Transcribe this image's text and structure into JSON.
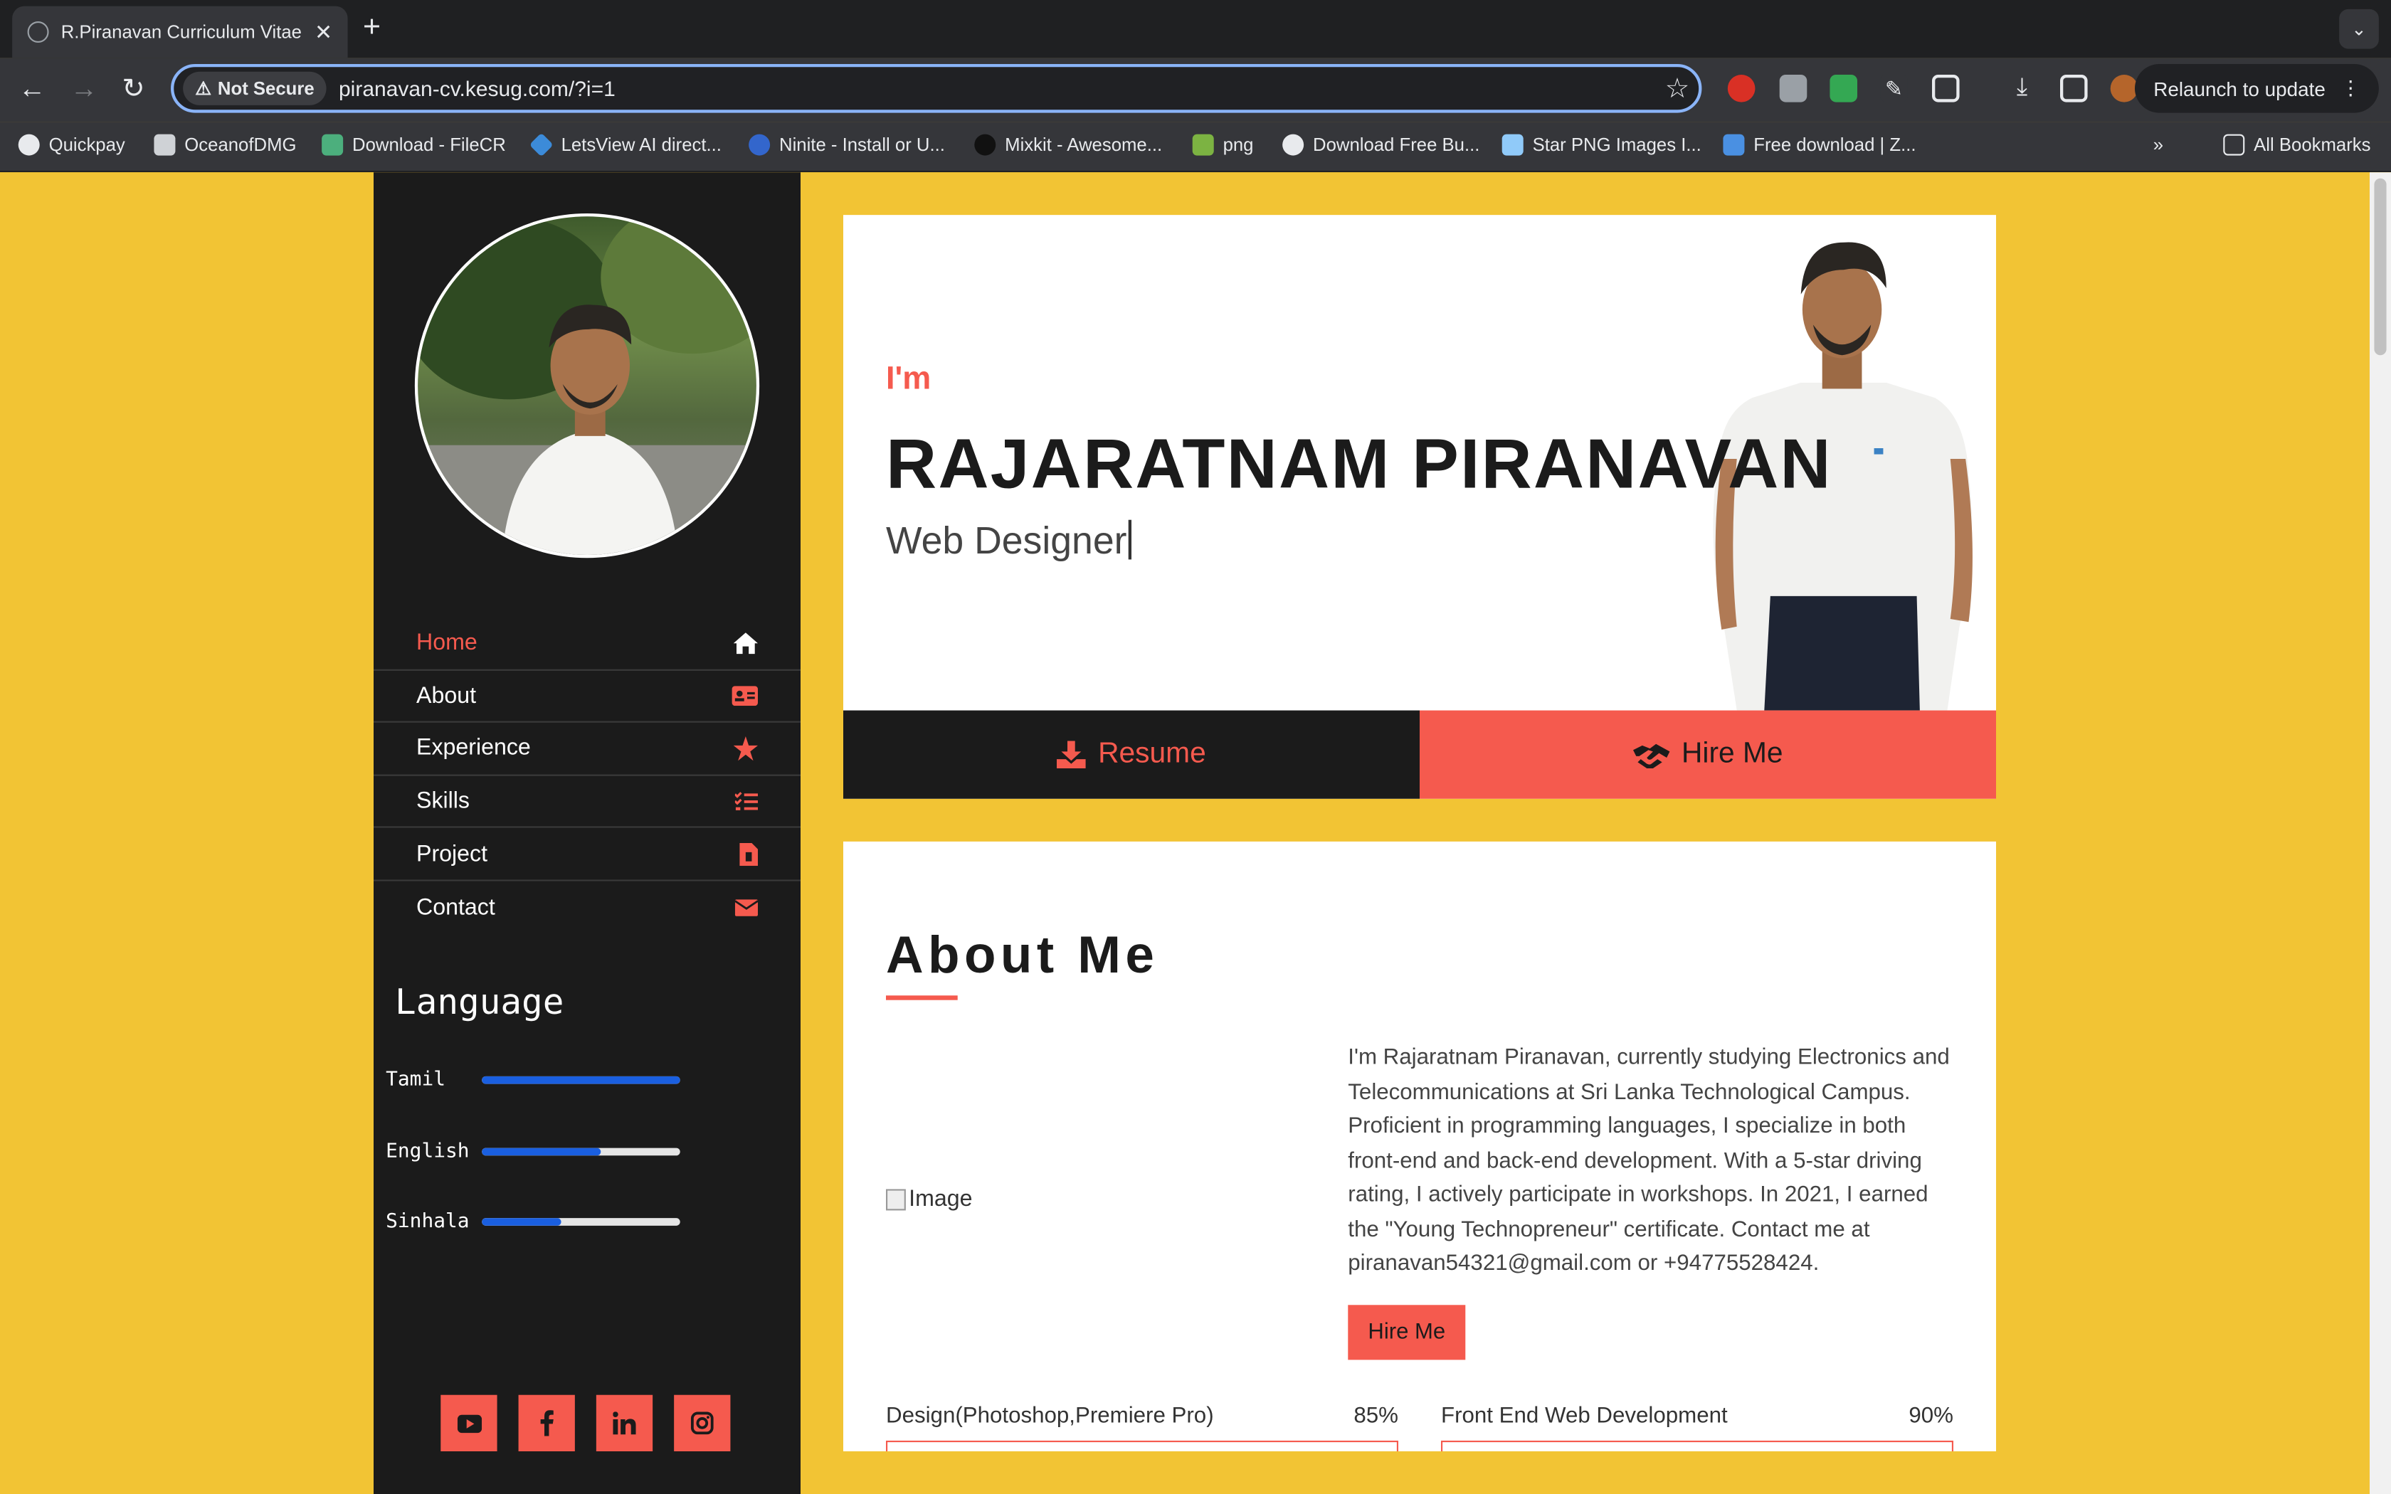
{
  "browser": {
    "tab_title": "R.Piranavan Curriculum Vitae",
    "tab_close": "✕",
    "new_tab": "+",
    "not_secure_label": "Not Secure",
    "url": "piranavan-cv.kesug.com/?i=1",
    "relaunch_label": "Relaunch to update",
    "bookmarks": [
      "Quickpay",
      "OceanofDMG",
      "Download - FileCR",
      "LetsView AI direct...",
      "Ninite - Install or U...",
      "Mixkit - Awesome...",
      "png",
      "Download Free Bu...",
      "Star PNG Images I...",
      "Free download | Z..."
    ],
    "all_bookmarks_label": "All Bookmarks"
  },
  "sidebar": {
    "menu": [
      {
        "label": "Home",
        "icon": "home-icon",
        "active": true
      },
      {
        "label": "About",
        "icon": "id-card-icon",
        "active": false
      },
      {
        "label": "Experience",
        "icon": "star-icon",
        "active": false
      },
      {
        "label": "Skills",
        "icon": "list-check-icon",
        "active": false
      },
      {
        "label": "Project",
        "icon": "file-icon",
        "active": false
      },
      {
        "label": "Contact",
        "icon": "envelope-icon",
        "active": false
      }
    ],
    "language_title": "Language",
    "languages": [
      {
        "name": "Tamil",
        "level": 1.0
      },
      {
        "name": "English",
        "level": 0.6
      },
      {
        "name": "Sinhala",
        "level": 0.4
      }
    ],
    "socials": [
      "youtube-icon",
      "facebook-icon",
      "linkedin-icon",
      "instagram-icon"
    ]
  },
  "hero": {
    "intro": "I'm",
    "name": "RAJARATNAM PIRANAVAN",
    "role": "Web Designer",
    "resume_label": "Resume",
    "hire_label": "Hire Me"
  },
  "about": {
    "heading": "About Me",
    "image_alt": "Image",
    "text": "I'm Rajaratnam Piranavan, currently studying Electronics and Telecommunications at Sri Lanka Technological Campus. Proficient in programming languages, I specialize in both front-end and back-end development. With a 5-star driving rating, I actively participate in workshops. In 2021, I earned the \"Young Technopreneur\" certificate. Contact me at piranavan54321@gmail.com or +94775528424.",
    "hire_button": "Hire Me",
    "skills": [
      {
        "name": "Design(Photoshop,Premiere Pro)",
        "percent": "85%"
      },
      {
        "name": "Front End Web Development",
        "percent": "90%"
      }
    ]
  },
  "colors": {
    "background": "#f2c434",
    "sidebar": "#1b1b1b",
    "accent": "#f55a4e",
    "language_bar": "#1a5fe0"
  }
}
